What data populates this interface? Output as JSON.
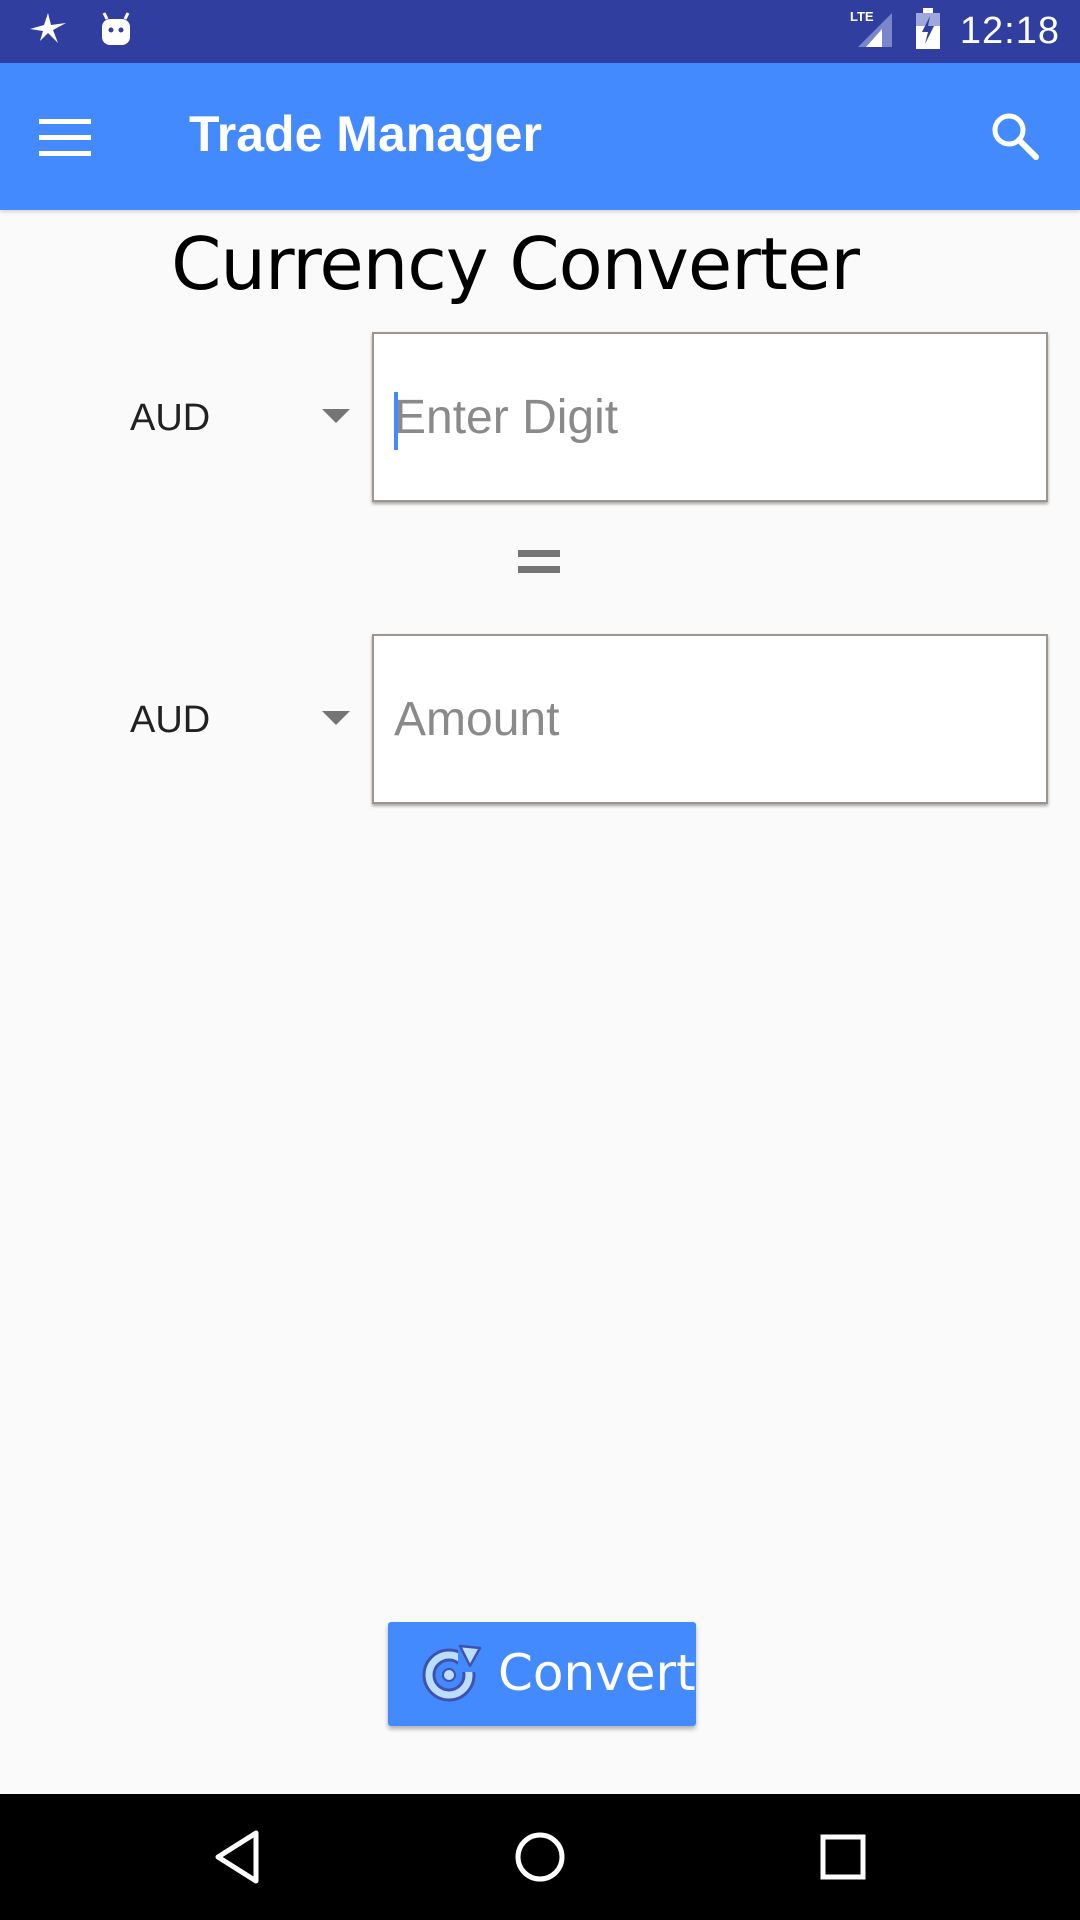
{
  "status_bar": {
    "time": "12:18",
    "network": "LTE",
    "icons": [
      "bird-notification-icon",
      "android-notification-icon",
      "lte-signal-icon",
      "battery-charging-icon"
    ]
  },
  "app_bar": {
    "title": "Trade Manager",
    "background_color": "#448aff",
    "menu_icon": "hamburger-menu-icon",
    "search_icon": "search-icon"
  },
  "converter": {
    "heading": "Currency Converter",
    "from": {
      "currency": "AUD",
      "input_value": "",
      "placeholder": "Enter Digit"
    },
    "equals_symbol": "=",
    "to": {
      "currency": "AUD",
      "input_value": "",
      "placeholder": "Amount"
    },
    "convert_button": {
      "label": "Convert",
      "icon": "refresh-convert-icon"
    }
  },
  "nav_bar": {
    "buttons": [
      "back-icon",
      "home-icon",
      "recents-icon"
    ]
  },
  "colors": {
    "status_bar": "#303f9f",
    "accent": "#448aff",
    "background": "#fafafa"
  }
}
